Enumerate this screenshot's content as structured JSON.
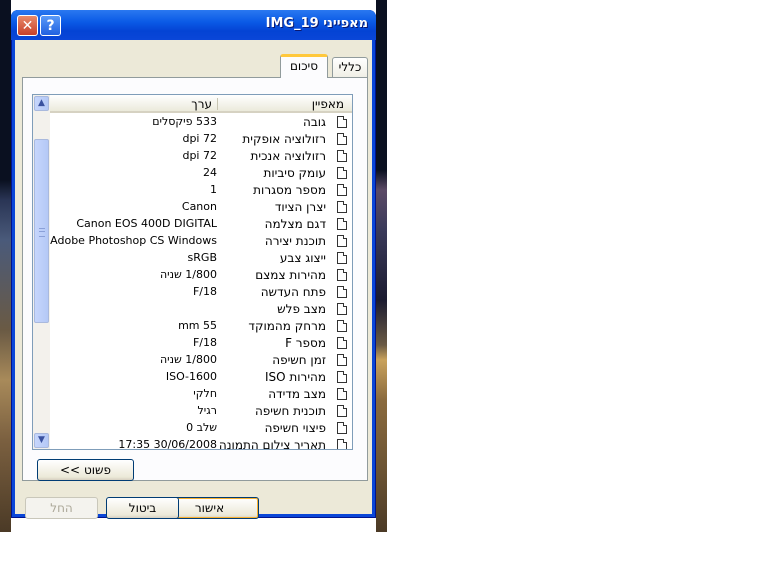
{
  "window": {
    "title": "מאפייני IMG_19",
    "close_icon": "close-icon",
    "help_label": "?"
  },
  "tabs": [
    {
      "label": "כללי",
      "active": false
    },
    {
      "label": "סיכום",
      "active": true
    }
  ],
  "list": {
    "columns": {
      "property": "מאפיין",
      "value": "ערך"
    },
    "rows": [
      {
        "name": "גובה",
        "value": "533 פיקסלים"
      },
      {
        "name": "רזולוציה אופקית",
        "value": "72 dpi"
      },
      {
        "name": "רזולוציה אנכית",
        "value": "72 dpi"
      },
      {
        "name": "עומק סיביות",
        "value": "24"
      },
      {
        "name": "מספר מסגרות",
        "value": "1"
      },
      {
        "name": "יצרן הציוד",
        "value": "Canon"
      },
      {
        "name": "דגם מצלמה",
        "value": "Canon EOS 400D DIGITAL"
      },
      {
        "name": "תוכנת יצירה",
        "value": "Adobe Photoshop CS Windows"
      },
      {
        "name": "ייצוג צבע",
        "value": "sRGB"
      },
      {
        "name": "מהירות צמצם",
        "value": "1/800 שניה"
      },
      {
        "name": "פתח העדשה",
        "value": "F/18"
      },
      {
        "name": "מצב פלש",
        "value": ""
      },
      {
        "name": "מרחק מהמוקד",
        "value": "55 mm"
      },
      {
        "name": "מספר F",
        "value": "F/18"
      },
      {
        "name": "זמן חשיפה",
        "value": "1/800 שניה"
      },
      {
        "name": "מהירות ISO",
        "value": "ISO-1600"
      },
      {
        "name": "מצב מדידה",
        "value": "חלקי"
      },
      {
        "name": "תוכנית חשיפה",
        "value": "רגיל"
      },
      {
        "name": "פיצוי חשיפה",
        "value": "שלב 0"
      },
      {
        "name": "תאריך צילום התמונה",
        "value": "30/06/2008 17:35"
      }
    ]
  },
  "buttons": {
    "simple": "<< פשוט",
    "ok": "אישור",
    "cancel": "ביטול",
    "apply": "החל"
  },
  "colors": {
    "titlebar": "#0a46d8",
    "face": "#ece9d8",
    "tab_highlight": "#ffc83c"
  }
}
